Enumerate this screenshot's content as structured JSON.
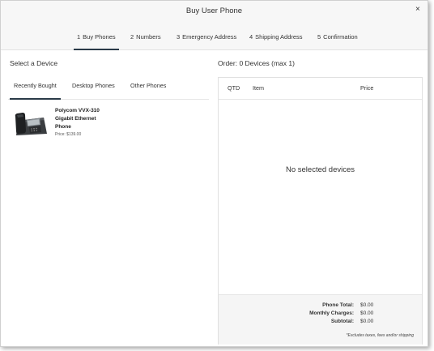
{
  "dialog": {
    "title": "Buy User Phone",
    "close_glyph": "×"
  },
  "steps": [
    {
      "num": "1",
      "label": "Buy Phones",
      "active": true
    },
    {
      "num": "2",
      "label": "Numbers",
      "active": false
    },
    {
      "num": "3",
      "label": "Emergency Address",
      "active": false
    },
    {
      "num": "4",
      "label": "Shipping Address",
      "active": false
    },
    {
      "num": "5",
      "label": "Confirmation",
      "active": false
    }
  ],
  "left": {
    "section_title": "Select a Device",
    "tabs": [
      {
        "label": "Recently Bought",
        "active": true
      },
      {
        "label": "Desktop Phones",
        "active": false
      },
      {
        "label": "Other Phones",
        "active": false
      }
    ],
    "devices": [
      {
        "name": "Polycom VVX-310 Gigabit Ethernet Phone",
        "price": "Price: $139.00",
        "icon": "desk-phone-icon"
      }
    ]
  },
  "order": {
    "title": "Order: 0 Devices (max 1)",
    "columns": {
      "qty": "QTD",
      "item": "Item",
      "price": "Price"
    },
    "empty_message": "No selected devices",
    "totals": [
      {
        "label": "Phone Total:",
        "value": "$0.00"
      },
      {
        "label": "Monthly Charges:",
        "value": "$0.00"
      },
      {
        "label": "Subtotal:",
        "value": "$0.00"
      }
    ],
    "note": "*Excludes taxes, fees and/or shipping"
  },
  "colors": {
    "accent": "#2a3a48",
    "header_bg": "#f7f7f7",
    "totals_bg": "#f5f5f5"
  }
}
